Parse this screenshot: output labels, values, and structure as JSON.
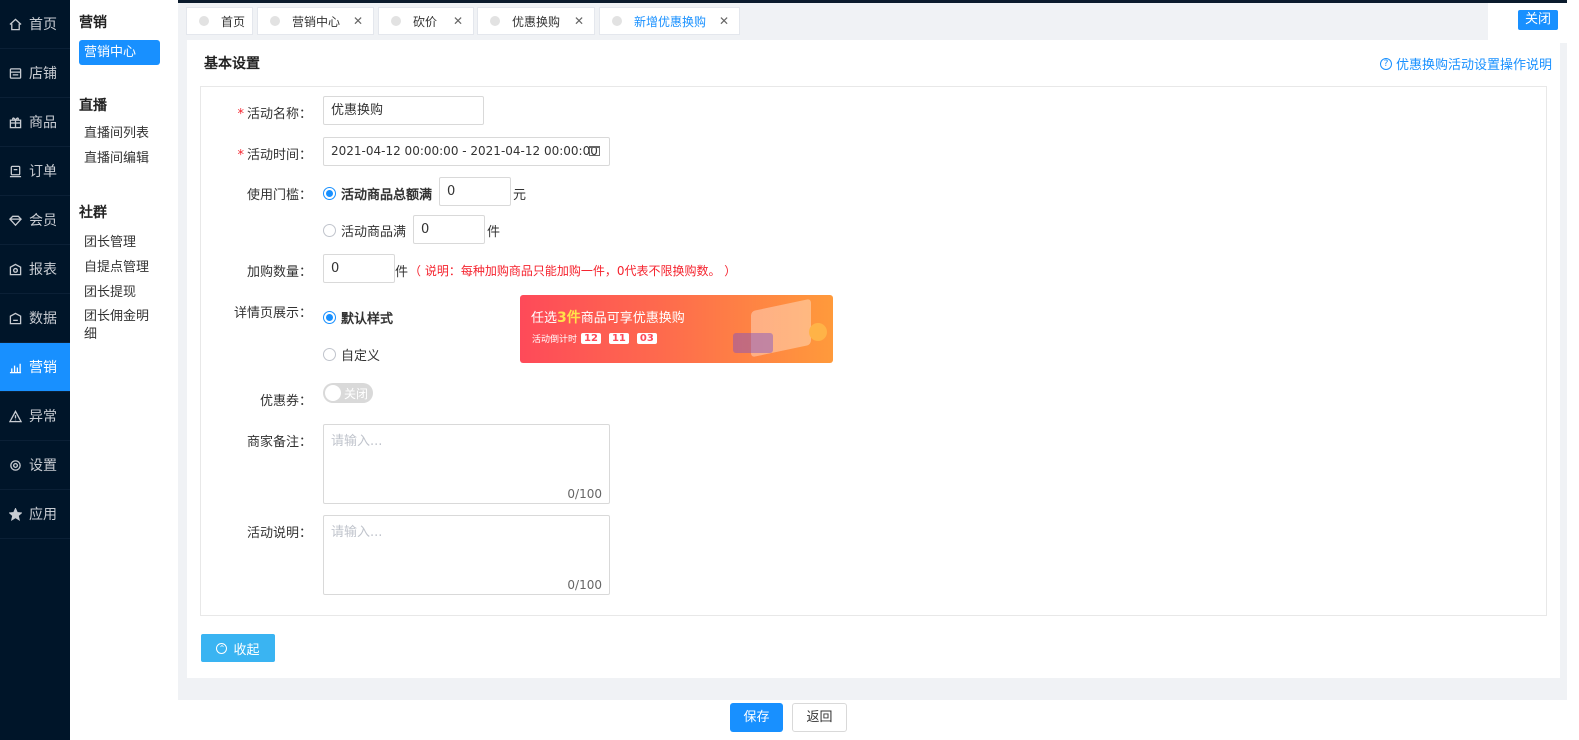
{
  "nav": {
    "items": [
      {
        "label": "首页",
        "icon": "home-icon"
      },
      {
        "label": "店铺",
        "icon": "shop-icon"
      },
      {
        "label": "商品",
        "icon": "gift-icon"
      },
      {
        "label": "订单",
        "icon": "order-icon"
      },
      {
        "label": "会员",
        "icon": "diamond-icon"
      },
      {
        "label": "报表",
        "icon": "report-icon"
      },
      {
        "label": "数据",
        "icon": "data-icon"
      },
      {
        "label": "营销",
        "icon": "bar-chart-icon"
      },
      {
        "label": "异常",
        "icon": "warning-icon"
      },
      {
        "label": "设置",
        "icon": "gear-icon"
      },
      {
        "label": "应用",
        "icon": "star-icon"
      }
    ],
    "active_index": 7
  },
  "submenu": {
    "groups": [
      {
        "title": "营销",
        "items": [
          "营销中心"
        ]
      },
      {
        "title": "直播",
        "items": [
          "直播间列表",
          "直播间编辑"
        ]
      },
      {
        "title": "社群",
        "items": [
          "团长管理",
          "自提点管理",
          "团长提现",
          "团长佣金明细"
        ]
      }
    ],
    "active_item": "营销中心"
  },
  "tabs": {
    "items": [
      "首页",
      "营销中心",
      "砍价",
      "优惠换购",
      "新增优惠换购"
    ],
    "active": "新增优惠换购",
    "close_all_label": "关闭"
  },
  "form": {
    "section_title": "基本设置",
    "help_link": "优惠换购活动设置操作说明",
    "name_label": "活动名称：",
    "name_value": "优惠换购",
    "time_label": "活动时间：",
    "time_value": "2021-04-12 00:00:00 - 2021-04-12 00:00:00",
    "threshold_label": "使用门槛：",
    "threshold_opt1": "活动商品总额满",
    "threshold_opt1_value": "0",
    "threshold_opt1_unit": "元",
    "threshold_opt2": "活动商品满",
    "threshold_opt2_value": "0",
    "threshold_opt2_unit": "件",
    "qty_label": "加购数量：",
    "qty_value": "0",
    "qty_unit": "件",
    "qty_note": "（ 说明：每种加购商品只能加购一件，0代表不限换购数。 ）",
    "detail_label": "详情页展示：",
    "detail_opt1": "默认样式",
    "detail_opt2": "自定义",
    "coupon_label": "优惠券：",
    "coupon_toggle": "关闭",
    "merchant_note_label": "商家备注：",
    "merchant_note_placeholder": "请输入...",
    "merchant_note_count": "0/100",
    "desc_label": "活动说明：",
    "desc_placeholder": "请输入...",
    "desc_count": "0/100",
    "collapse_label": "收起"
  },
  "banner": {
    "prefix": "任选",
    "highlight": "3件",
    "suffix": "商品可享优惠换购",
    "countdown_label": "活动倒计时",
    "h": "12",
    "m": "11",
    "s": "03"
  },
  "footer": {
    "save_label": "保存",
    "back_label": "返回"
  }
}
